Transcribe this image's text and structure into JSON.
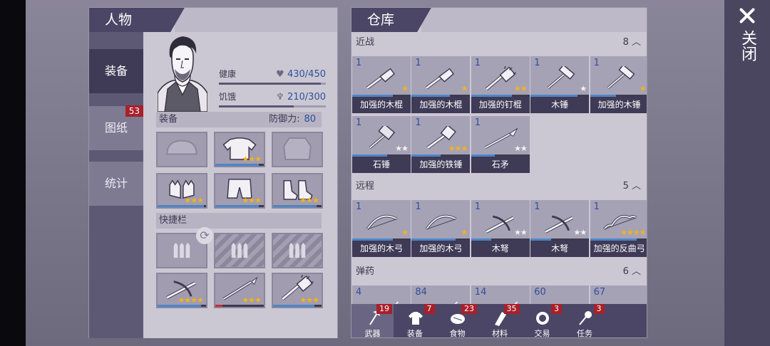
{
  "character": {
    "title": "人物",
    "tabs": [
      {
        "label": "装备",
        "badge": ""
      },
      {
        "label": "图纸",
        "badge": "53"
      },
      {
        "label": "统计",
        "badge": ""
      }
    ],
    "stats": [
      {
        "name": "健康",
        "icon": "heart-icon",
        "value": "430/450",
        "fraction": 0.956
      },
      {
        "name": "饥饿",
        "icon": "stomach-icon",
        "value": "210/300",
        "fraction": 0.7
      }
    ],
    "equipment_label": "装备",
    "defense_label": "防御力:",
    "defense_value": "80",
    "equip_slots": [
      {
        "name": "helmet-slot",
        "icon": "helmet-icon",
        "stars": "",
        "durability": 0
      },
      {
        "name": "shirt-slot",
        "icon": "shirt-icon",
        "stars": "★★★",
        "durability": 0.9
      },
      {
        "name": "jacket-slot",
        "icon": "jacket-icon",
        "stars": "",
        "durability": 0
      },
      {
        "name": "gloves-slot",
        "icon": "gloves-icon",
        "stars": "★★★",
        "durability": 0.95
      },
      {
        "name": "pants-slot",
        "icon": "shorts-icon",
        "stars": "★★★",
        "durability": 0.9
      },
      {
        "name": "boots-slot",
        "icon": "boots-icon",
        "stars": "★★★",
        "durability": 0.9
      }
    ],
    "quickbar_label": "快捷栏",
    "quickbar_slots": [
      {
        "name": "ammo-slot-1",
        "icon": "ammo-icon",
        "stars": "",
        "locked": false
      },
      {
        "name": "ammo-slot-2",
        "icon": "ammo-icon",
        "stars": "",
        "locked": true
      },
      {
        "name": "ammo-slot-3",
        "icon": "ammo-icon",
        "stars": "",
        "locked": true
      },
      {
        "name": "crossbow-slot",
        "icon": "crossbow-icon",
        "stars": "★★★★",
        "durability": 0.9
      },
      {
        "name": "spear-slot",
        "icon": "spear-icon",
        "stars": "★★★",
        "durability": 0.15
      },
      {
        "name": "spiked-club-slot",
        "icon": "spiked-club-icon",
        "stars": "★★★",
        "durability": 0.85
      }
    ]
  },
  "storage": {
    "title": "仓库",
    "categories": [
      {
        "name": "近战",
        "count": "8"
      },
      {
        "name": "远程",
        "count": "5"
      },
      {
        "name": "弹药",
        "count": "6"
      }
    ],
    "melee": [
      {
        "qty": "1",
        "label": "加强的木棍",
        "icon": "wooden-club-icon",
        "stars": "★",
        "star_color": "gold",
        "durability": 0.7
      },
      {
        "qty": "1",
        "label": "加强的木棍",
        "icon": "wooden-club-icon",
        "stars": "★",
        "star_color": "gold",
        "durability": 0.65
      },
      {
        "qty": "1",
        "label": "加强的钉棍",
        "icon": "spiked-club-icon",
        "stars": "★★",
        "star_color": "gold",
        "durability": 0.7
      },
      {
        "qty": "1",
        "label": "木锤",
        "icon": "hammer-icon",
        "stars": "★",
        "star_color": "white",
        "durability": 0.8
      },
      {
        "qty": "1",
        "label": "加强的木锤",
        "icon": "hammer-icon",
        "stars": "★",
        "star_color": "gold",
        "durability": 0.45
      },
      {
        "qty": "1",
        "label": "石锤",
        "icon": "stone-hammer-icon",
        "stars": "★★",
        "star_color": "white",
        "durability": 0.6
      },
      {
        "qty": "1",
        "label": "加强的铁锤",
        "icon": "iron-hammer-icon",
        "stars": "★★★",
        "star_color": "gold",
        "durability": 0.5
      },
      {
        "qty": "1",
        "label": "石矛",
        "icon": "stone-spear-icon",
        "stars": "★★",
        "star_color": "white",
        "durability": 0.4
      }
    ],
    "ranged": [
      {
        "qty": "1",
        "label": "加强的木弓",
        "icon": "bow-icon",
        "stars": "★",
        "star_color": "gold",
        "durability": 0.7
      },
      {
        "qty": "1",
        "label": "加强的木弓",
        "icon": "bow-icon",
        "stars": "★",
        "star_color": "gold",
        "durability": 0.75
      },
      {
        "qty": "1",
        "label": "木弩",
        "icon": "crossbow-icon",
        "stars": "★★",
        "star_color": "white",
        "durability": 0.35
      },
      {
        "qty": "1",
        "label": "木弩",
        "icon": "crossbow-icon",
        "stars": "★★",
        "star_color": "white",
        "durability": 0.35
      },
      {
        "qty": "1",
        "label": "加强的反曲弓",
        "icon": "recurve-bow-icon",
        "stars": "★★★★",
        "star_color": "gold",
        "durability": 0.8
      }
    ],
    "ammo": [
      {
        "qty": "4",
        "icon": "arrow-icon"
      },
      {
        "qty": "84",
        "icon": "arrow-icon"
      },
      {
        "qty": "14",
        "icon": "arrow-icon"
      },
      {
        "qty": "60",
        "icon": "bolt-icon"
      },
      {
        "qty": "67",
        "icon": "bolt-icon"
      }
    ],
    "bottom_tabs": [
      {
        "label": "武器",
        "badge": "19",
        "icon": "axe-icon"
      },
      {
        "label": "装备",
        "badge": "7",
        "icon": "shirt-icon"
      },
      {
        "label": "食物",
        "badge": "23",
        "icon": "food-icon"
      },
      {
        "label": "材料",
        "badge": "35",
        "icon": "material-icon"
      },
      {
        "label": "交易",
        "badge": "3",
        "icon": "trade-icon"
      },
      {
        "label": "任务",
        "badge": "3",
        "icon": "key-icon"
      }
    ]
  },
  "close_label": "关闭"
}
